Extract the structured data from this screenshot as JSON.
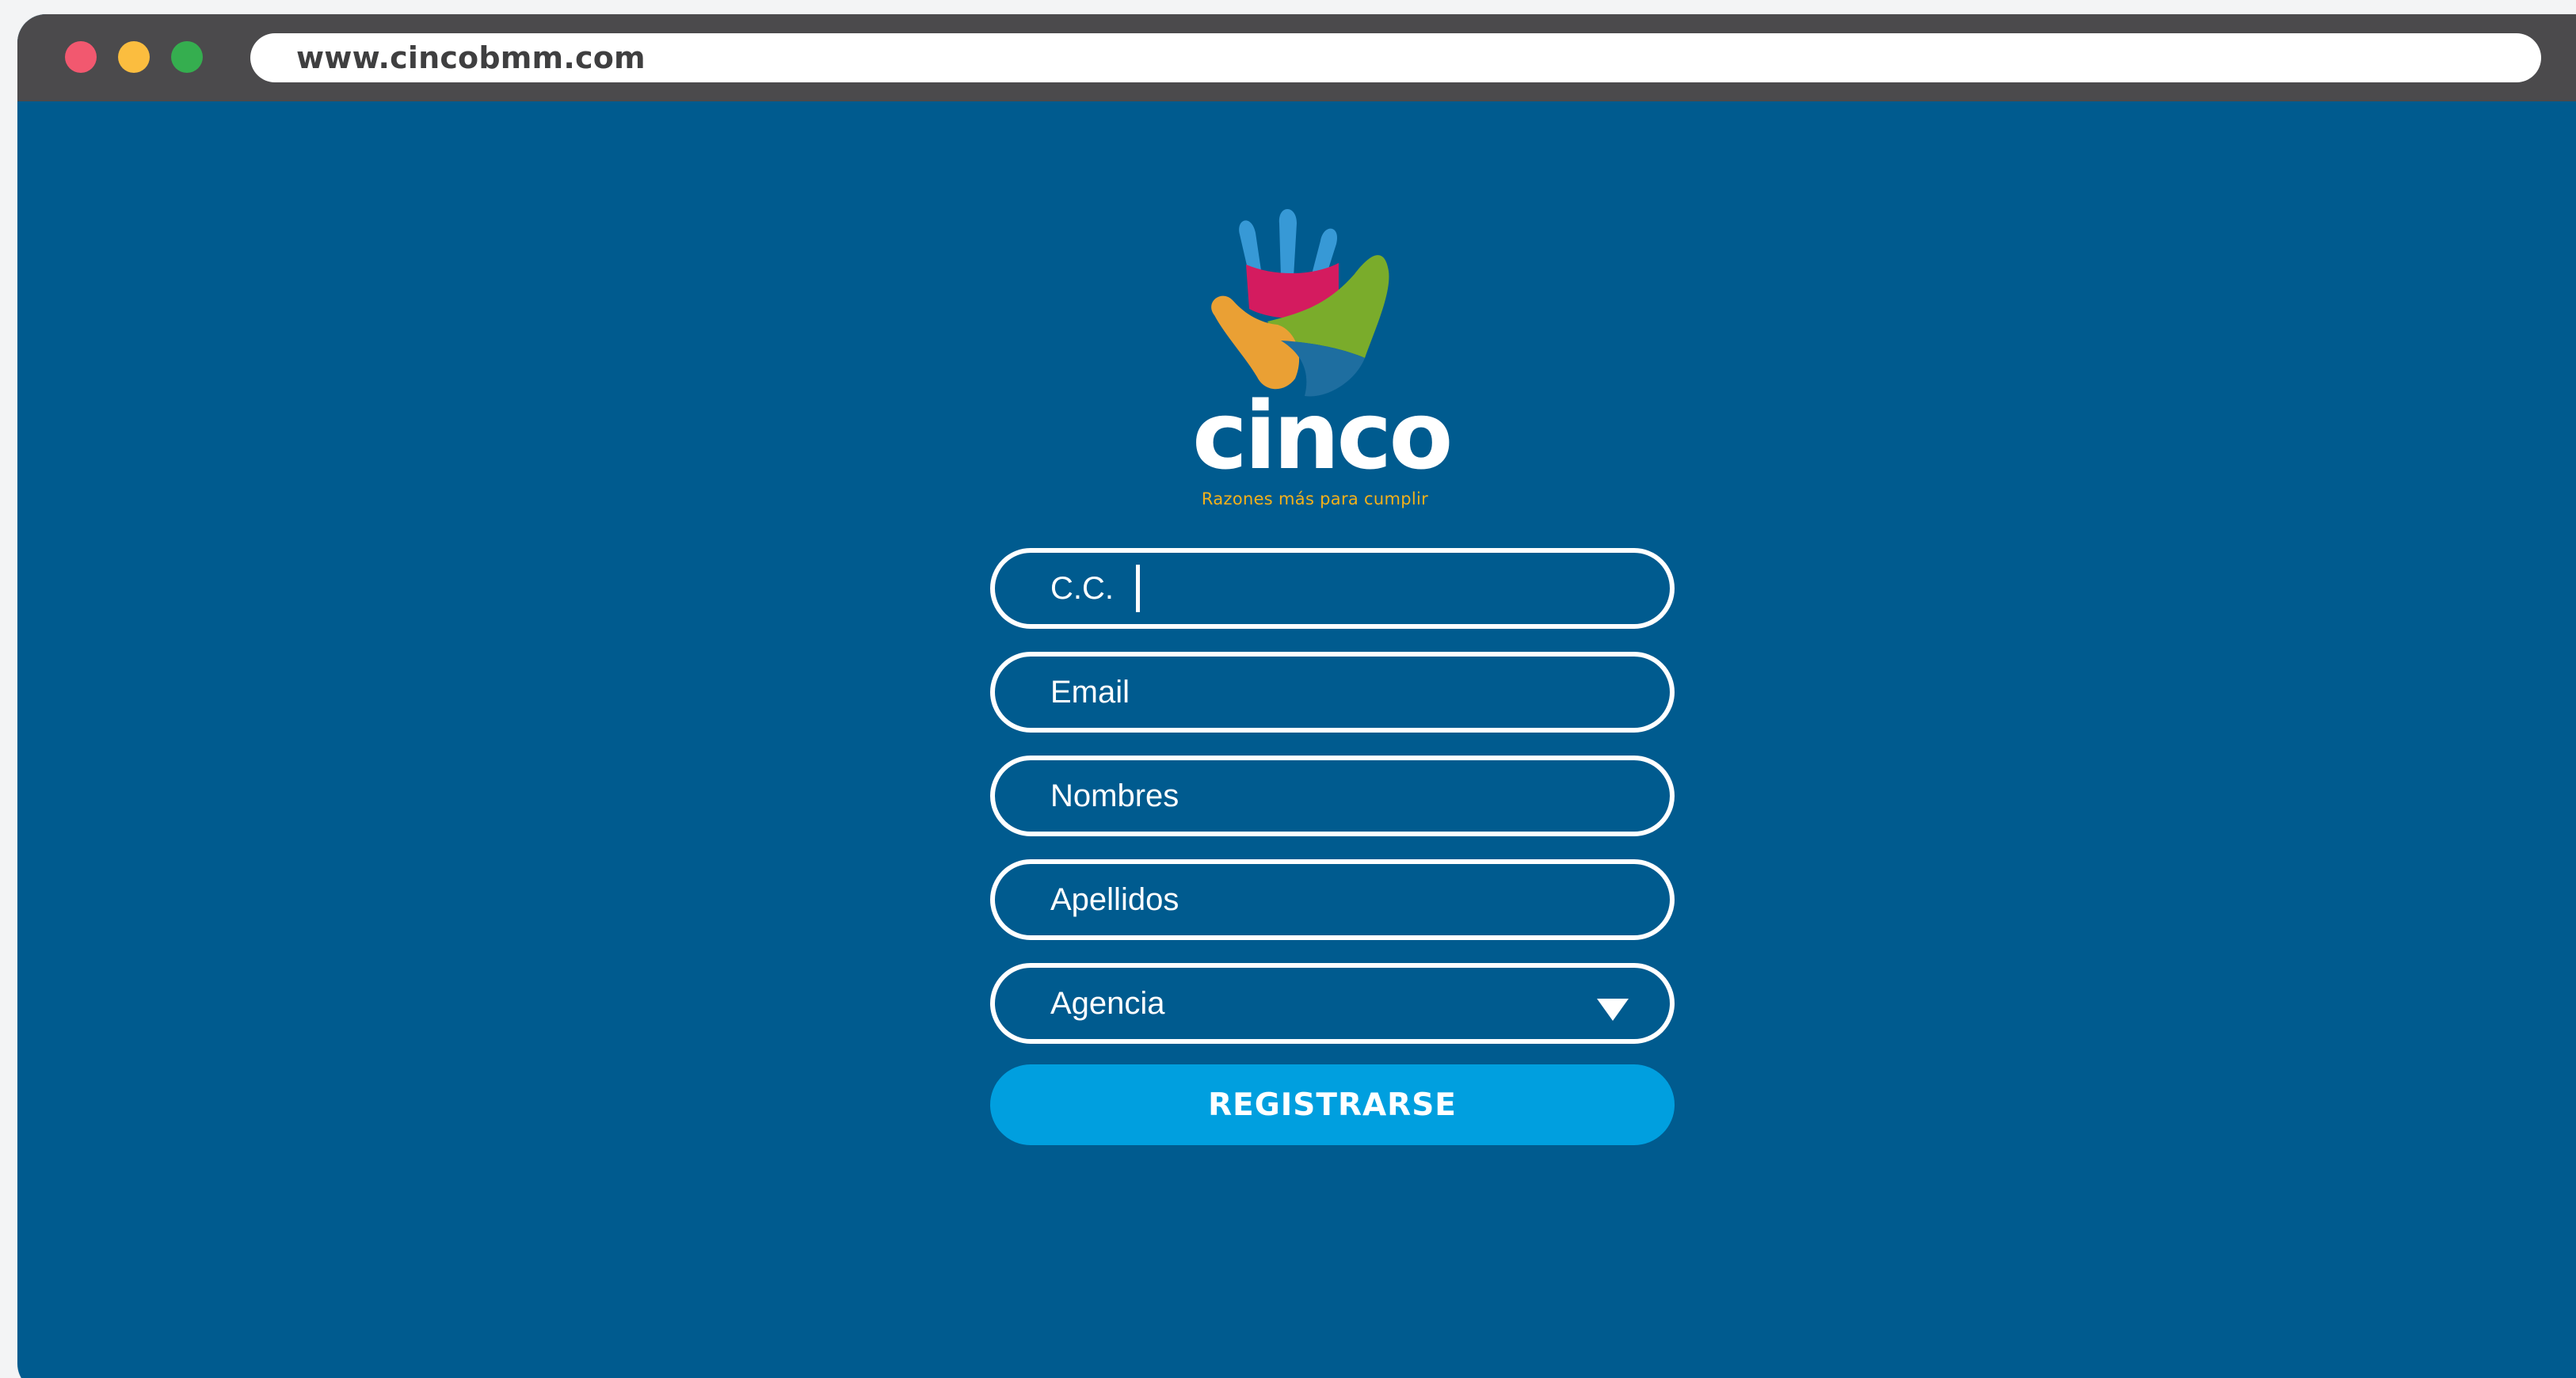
{
  "browser": {
    "url": "www.cincobmm.com",
    "window_controls": [
      "close",
      "minimize",
      "maximize"
    ]
  },
  "brand": {
    "name": "cinco",
    "tagline": "Razones más para cumplir",
    "icon": "hand-logo-icon"
  },
  "form": {
    "cc_label": "C.C.",
    "email_label": "Email",
    "nombres_label": "Nombres",
    "apellidos_label": "Apellidos",
    "agencia_label": "Agencia",
    "submit_label": "REGISTRARSE"
  },
  "colors": {
    "page_background": "#005b8f",
    "titlebar": "#4b4a4c",
    "button": "#009fdf",
    "tagline": "#f3b11a"
  }
}
